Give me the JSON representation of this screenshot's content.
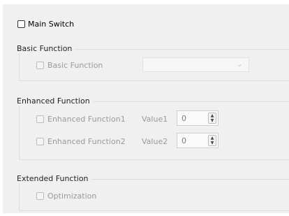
{
  "main_switch": {
    "label": "Main Switch",
    "checked": false
  },
  "basic": {
    "title": "Basic Function",
    "checkbox_label": "Basic Function",
    "combo_value": "",
    "combo_arrow": "chevron-down-icon"
  },
  "enhanced": {
    "title": "Enhanced Function",
    "rows": [
      {
        "checkbox_label": "Enhanced Function1",
        "value_label": "Value1",
        "value": "0"
      },
      {
        "checkbox_label": "Enhanced Function2",
        "value_label": "Value2",
        "value": "0"
      }
    ]
  },
  "extended": {
    "title": "Extended Function",
    "checkbox_label": "Optimization"
  },
  "icons": {
    "spin_up": "▲",
    "spin_down": "▼",
    "combo_arrow": "⌄"
  }
}
